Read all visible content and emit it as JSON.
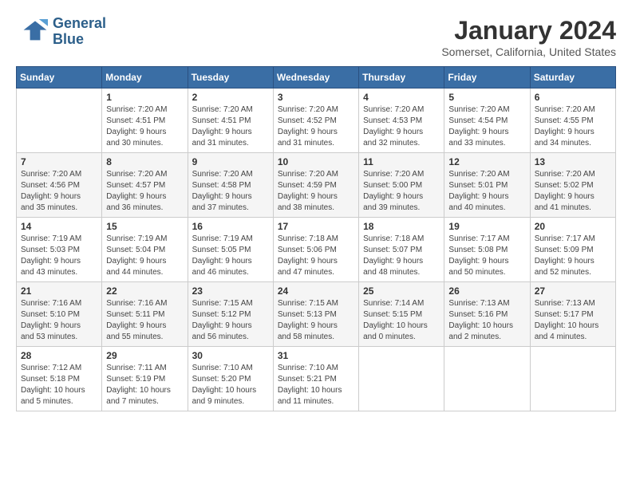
{
  "logo": {
    "line1": "General",
    "line2": "Blue"
  },
  "title": "January 2024",
  "subtitle": "Somerset, California, United States",
  "headers": [
    "Sunday",
    "Monday",
    "Tuesday",
    "Wednesday",
    "Thursday",
    "Friday",
    "Saturday"
  ],
  "weeks": [
    [
      {
        "num": "",
        "info": ""
      },
      {
        "num": "1",
        "info": "Sunrise: 7:20 AM\nSunset: 4:51 PM\nDaylight: 9 hours\nand 30 minutes."
      },
      {
        "num": "2",
        "info": "Sunrise: 7:20 AM\nSunset: 4:51 PM\nDaylight: 9 hours\nand 31 minutes."
      },
      {
        "num": "3",
        "info": "Sunrise: 7:20 AM\nSunset: 4:52 PM\nDaylight: 9 hours\nand 31 minutes."
      },
      {
        "num": "4",
        "info": "Sunrise: 7:20 AM\nSunset: 4:53 PM\nDaylight: 9 hours\nand 32 minutes."
      },
      {
        "num": "5",
        "info": "Sunrise: 7:20 AM\nSunset: 4:54 PM\nDaylight: 9 hours\nand 33 minutes."
      },
      {
        "num": "6",
        "info": "Sunrise: 7:20 AM\nSunset: 4:55 PM\nDaylight: 9 hours\nand 34 minutes."
      }
    ],
    [
      {
        "num": "7",
        "info": "Sunrise: 7:20 AM\nSunset: 4:56 PM\nDaylight: 9 hours\nand 35 minutes."
      },
      {
        "num": "8",
        "info": "Sunrise: 7:20 AM\nSunset: 4:57 PM\nDaylight: 9 hours\nand 36 minutes."
      },
      {
        "num": "9",
        "info": "Sunrise: 7:20 AM\nSunset: 4:58 PM\nDaylight: 9 hours\nand 37 minutes."
      },
      {
        "num": "10",
        "info": "Sunrise: 7:20 AM\nSunset: 4:59 PM\nDaylight: 9 hours\nand 38 minutes."
      },
      {
        "num": "11",
        "info": "Sunrise: 7:20 AM\nSunset: 5:00 PM\nDaylight: 9 hours\nand 39 minutes."
      },
      {
        "num": "12",
        "info": "Sunrise: 7:20 AM\nSunset: 5:01 PM\nDaylight: 9 hours\nand 40 minutes."
      },
      {
        "num": "13",
        "info": "Sunrise: 7:20 AM\nSunset: 5:02 PM\nDaylight: 9 hours\nand 41 minutes."
      }
    ],
    [
      {
        "num": "14",
        "info": "Sunrise: 7:19 AM\nSunset: 5:03 PM\nDaylight: 9 hours\nand 43 minutes."
      },
      {
        "num": "15",
        "info": "Sunrise: 7:19 AM\nSunset: 5:04 PM\nDaylight: 9 hours\nand 44 minutes."
      },
      {
        "num": "16",
        "info": "Sunrise: 7:19 AM\nSunset: 5:05 PM\nDaylight: 9 hours\nand 46 minutes."
      },
      {
        "num": "17",
        "info": "Sunrise: 7:18 AM\nSunset: 5:06 PM\nDaylight: 9 hours\nand 47 minutes."
      },
      {
        "num": "18",
        "info": "Sunrise: 7:18 AM\nSunset: 5:07 PM\nDaylight: 9 hours\nand 48 minutes."
      },
      {
        "num": "19",
        "info": "Sunrise: 7:17 AM\nSunset: 5:08 PM\nDaylight: 9 hours\nand 50 minutes."
      },
      {
        "num": "20",
        "info": "Sunrise: 7:17 AM\nSunset: 5:09 PM\nDaylight: 9 hours\nand 52 minutes."
      }
    ],
    [
      {
        "num": "21",
        "info": "Sunrise: 7:16 AM\nSunset: 5:10 PM\nDaylight: 9 hours\nand 53 minutes."
      },
      {
        "num": "22",
        "info": "Sunrise: 7:16 AM\nSunset: 5:11 PM\nDaylight: 9 hours\nand 55 minutes."
      },
      {
        "num": "23",
        "info": "Sunrise: 7:15 AM\nSunset: 5:12 PM\nDaylight: 9 hours\nand 56 minutes."
      },
      {
        "num": "24",
        "info": "Sunrise: 7:15 AM\nSunset: 5:13 PM\nDaylight: 9 hours\nand 58 minutes."
      },
      {
        "num": "25",
        "info": "Sunrise: 7:14 AM\nSunset: 5:15 PM\nDaylight: 10 hours\nand 0 minutes."
      },
      {
        "num": "26",
        "info": "Sunrise: 7:13 AM\nSunset: 5:16 PM\nDaylight: 10 hours\nand 2 minutes."
      },
      {
        "num": "27",
        "info": "Sunrise: 7:13 AM\nSunset: 5:17 PM\nDaylight: 10 hours\nand 4 minutes."
      }
    ],
    [
      {
        "num": "28",
        "info": "Sunrise: 7:12 AM\nSunset: 5:18 PM\nDaylight: 10 hours\nand 5 minutes."
      },
      {
        "num": "29",
        "info": "Sunrise: 7:11 AM\nSunset: 5:19 PM\nDaylight: 10 hours\nand 7 minutes."
      },
      {
        "num": "30",
        "info": "Sunrise: 7:10 AM\nSunset: 5:20 PM\nDaylight: 10 hours\nand 9 minutes."
      },
      {
        "num": "31",
        "info": "Sunrise: 7:10 AM\nSunset: 5:21 PM\nDaylight: 10 hours\nand 11 minutes."
      },
      {
        "num": "",
        "info": ""
      },
      {
        "num": "",
        "info": ""
      },
      {
        "num": "",
        "info": ""
      }
    ]
  ]
}
